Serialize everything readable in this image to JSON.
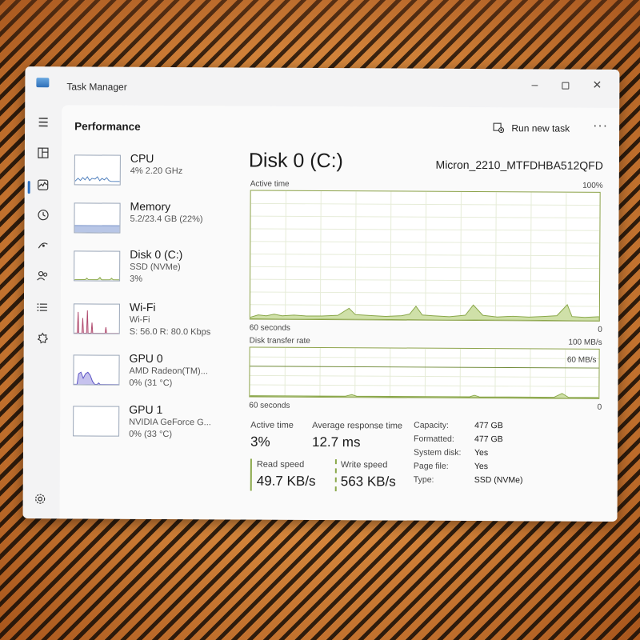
{
  "window": {
    "app_title": "Task Manager",
    "minimize_glyph": "–",
    "close_glyph": "✕"
  },
  "nav": {
    "icons": [
      "hamburger-icon",
      "processes-icon",
      "performance-icon",
      "app-history-icon",
      "startup-apps-icon",
      "users-icon",
      "details-icon",
      "services-icon",
      "settings-icon"
    ],
    "active": "performance"
  },
  "header": {
    "page_title": "Performance",
    "run_new_task": "Run new task",
    "more_glyph": "···"
  },
  "devices": [
    {
      "name": "CPU",
      "sub1": "4% 2.20 GHz",
      "sub2": "",
      "color": "#4f7fbd"
    },
    {
      "name": "Memory",
      "sub1": "5.2/23.4 GB (22%)",
      "sub2": "",
      "color": "#7a94c9",
      "level": 0.22
    },
    {
      "name": "Disk 0 (C:)",
      "sub1": "SSD (NVMe)",
      "sub2": "3%",
      "color": "#8aa84a"
    },
    {
      "name": "Wi-Fi",
      "sub1": "Wi-Fi",
      "sub2": "S: 56.0 R: 80.0 Kbps",
      "color": "#b04a6e"
    },
    {
      "name": "GPU 0",
      "sub1": "AMD Radeon(TM)...",
      "sub2": "0% (31 °C)",
      "color": "#5a52c4"
    },
    {
      "name": "GPU 1",
      "sub1": "NVIDIA GeForce G...",
      "sub2": "0% (33 °C)",
      "color": "#5a52c4"
    }
  ],
  "disk": {
    "title": "Disk 0 (C:)",
    "model": "Micron_2210_MTFDHBA512QFD",
    "active_time_label": "Active time",
    "active_time_max": "100%",
    "active_time_xlabel": "60 seconds",
    "active_time_min": "0",
    "transfer_label": "Disk transfer rate",
    "transfer_max": "100 MB/s",
    "transfer_mid": "60 MB/s",
    "transfer_xlabel": "60 seconds",
    "transfer_min": "0",
    "stats": {
      "active_time_label": "Active time",
      "active_time_value": "3%",
      "avg_response_label": "Average response time",
      "avg_response_value": "12.7 ms",
      "read_label": "Read speed",
      "read_value": "49.7 KB/s",
      "write_label": "Write speed",
      "write_value": "563 KB/s"
    },
    "props": [
      {
        "label": "Capacity:",
        "value": "477 GB"
      },
      {
        "label": "Formatted:",
        "value": "477 GB"
      },
      {
        "label": "System disk:",
        "value": "Yes"
      },
      {
        "label": "Page file:",
        "value": "Yes"
      },
      {
        "label": "Type:",
        "value": "SSD (NVMe)"
      }
    ],
    "colors": {
      "accent": "#8aa84a",
      "fill": "#cfe0a8",
      "read": "#8aa84a",
      "write": "#8aa84a"
    }
  }
}
